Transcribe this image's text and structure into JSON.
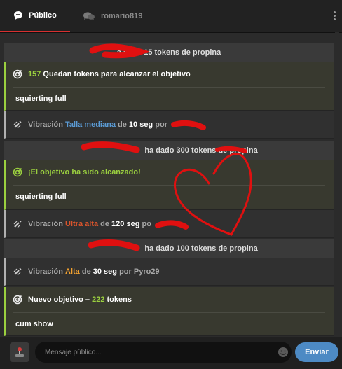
{
  "tabs": {
    "public_label": "Público",
    "user_label": "romario819"
  },
  "messages": {
    "tip1": {
      "text": "a dado 15 tokens de propina"
    },
    "goal1": {
      "count": "157",
      "text": " Quedan tokens para alcanzar el objetivo",
      "subject": "squierting full"
    },
    "vib1": {
      "prefix": "Vibración",
      "level": "Talla mediana",
      "mid": "de",
      "duration": "10 seg",
      "por": "por"
    },
    "tip2": {
      "text": "ha dado 300 tokens de propina"
    },
    "goal2": {
      "text": "¡El objetivo ha sido alcanzado!",
      "subject": "squierting full"
    },
    "vib2": {
      "prefix": "Vibración",
      "level": "Ultra alta",
      "mid": "de",
      "duration": "120 seg",
      "por": "po"
    },
    "tip3": {
      "text": "ha dado 100 tokens de propina"
    },
    "vib3": {
      "prefix": "Vibración",
      "level": "Alta",
      "mid": "de",
      "duration": "30 seg",
      "por": "por",
      "user": "Pyro29"
    },
    "goal3": {
      "label": "Nuevo objetivo –",
      "count": "222",
      "suffix": "tokens",
      "subject": "cum show"
    }
  },
  "composer": {
    "placeholder": "Mensaje público...",
    "send_label": "Enviar"
  },
  "colors": {
    "accent_tab": "#d73030",
    "goal_green": "#9bd03f",
    "send_blue": "#4d8ac4",
    "level_mediana": "#5b9bd5",
    "level_ultra": "#d9542c",
    "level_alta": "#f0a030",
    "scribble": "#e01010"
  }
}
